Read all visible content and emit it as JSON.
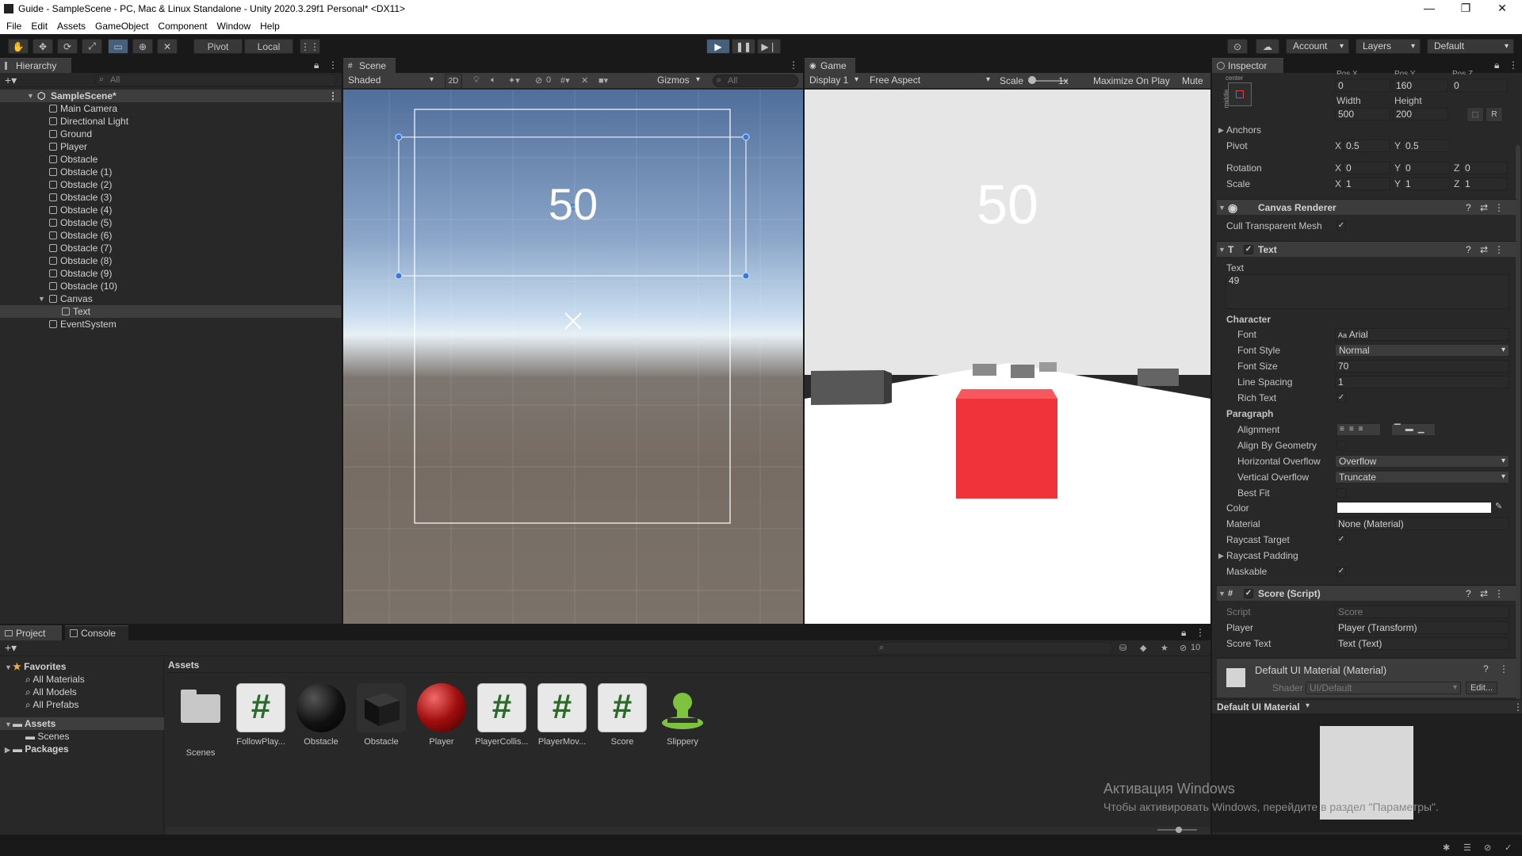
{
  "window": {
    "title": "Guide - SampleScene - PC, Mac & Linux Standalone - Unity 2020.3.29f1 Personal* <DX11>",
    "minimize": "—",
    "maximize": "❐",
    "close": "✕"
  },
  "menu": [
    "File",
    "Edit",
    "Assets",
    "GameObject",
    "Component",
    "Window",
    "Help"
  ],
  "toolbar": {
    "pivot_label": "Pivot",
    "local_label": "Local",
    "account_label": "Account",
    "layers_label": "Layers",
    "layout_label": "Default"
  },
  "hierarchy": {
    "tab_label": "Hierarchy",
    "search_placeholder": "All",
    "scene_name": "SampleScene*",
    "items": [
      "Main Camera",
      "Directional Light",
      "Ground",
      "Player",
      "Obstacle",
      "Obstacle (1)",
      "Obstacle (2)",
      "Obstacle (3)",
      "Obstacle (4)",
      "Obstacle (5)",
      "Obstacle (6)",
      "Obstacle (7)",
      "Obstacle (8)",
      "Obstacle (9)",
      "Obstacle (10)",
      "Canvas"
    ],
    "child_item": "Text",
    "last_item": "EventSystem"
  },
  "scene": {
    "tab_label": "Scene",
    "shading_mode": "Shaded",
    "btn_2d": "2D",
    "hidden_count": "0",
    "gizmos_label": "Gizmos",
    "search_placeholder": "All",
    "ui_text": "50"
  },
  "game": {
    "tab_label": "Game",
    "display": "Display 1",
    "aspect": "Free Aspect",
    "scale_label": "Scale",
    "scale_value": "1x",
    "maximize_label": "Maximize On Play",
    "mute_label": "Mute",
    "score_text": "50",
    "sky_color": "#e6e6e6",
    "ground_color": "#ffffff",
    "player_color": "#f0323a"
  },
  "inspector": {
    "tab_label": "Inspector",
    "rect": {
      "posx_label": "Pos X",
      "posy_label": "Pos Y",
      "posz_label": "Pos Z",
      "posx": "0",
      "posy": "160",
      "posz": "0",
      "width_label": "Width",
      "height_label": "Height",
      "width": "500",
      "height": "200",
      "anchor_preset_top": "center",
      "anchor_preset_side": "middle",
      "anchors_label": "Anchors",
      "pivot_label": "Pivot",
      "pivot_x": "0.5",
      "pivot_y": "0.5",
      "rotation_label": "Rotation",
      "rot_x": "0",
      "rot_y": "0",
      "rot_z": "0",
      "scale_label": "Scale",
      "scale_x": "1",
      "scale_y": "1",
      "scale_z": "1",
      "r_button": "R"
    },
    "axis_labels": {
      "x": "X",
      "y": "Y",
      "z": "Z"
    },
    "canvas_renderer": {
      "title": "Canvas Renderer",
      "cull_label": "Cull Transparent Mesh"
    },
    "text_comp": {
      "title": "Text",
      "text_label": "Text",
      "text_value": "49",
      "character_label": "Character",
      "font_label": "Font",
      "font_value": "Arial",
      "font_style_label": "Font Style",
      "font_style_value": "Normal",
      "font_size_label": "Font Size",
      "font_size_value": "70",
      "line_spacing_label": "Line Spacing",
      "line_spacing_value": "1",
      "rich_text_label": "Rich Text",
      "paragraph_label": "Paragraph",
      "alignment_label": "Alignment",
      "align_geom_label": "Align By Geometry",
      "h_overflow_label": "Horizontal Overflow",
      "h_overflow_value": "Overflow",
      "v_overflow_label": "Vertical Overflow",
      "v_overflow_value": "Truncate",
      "best_fit_label": "Best Fit",
      "color_label": "Color",
      "color_value": "#ffffff",
      "material_label": "Material",
      "material_value": "None (Material)",
      "raycast_target_label": "Raycast Target",
      "raycast_padding_label": "Raycast Padding",
      "maskable_label": "Maskable"
    },
    "score_comp": {
      "title": "Score (Script)",
      "script_label": "Script",
      "script_value": "Score",
      "player_label": "Player",
      "player_value": "Player (Transform)",
      "score_text_label": "Score Text",
      "score_text_value": "Text (Text)"
    },
    "material": {
      "title": "Default UI Material (Material)",
      "shader_label": "Shader",
      "shader_value": "UI/Default",
      "edit_label": "Edit...",
      "preview_label": "Default UI Material"
    }
  },
  "project": {
    "tab_project": "Project",
    "tab_console": "Console",
    "hidden_count": "10",
    "favorites_label": "Favorites",
    "favorites": [
      "All Materials",
      "All Models",
      "All Prefabs"
    ],
    "assets_label": "Assets",
    "assets_children": [
      "Scenes"
    ],
    "packages_label": "Packages",
    "breadcrumb": "Assets",
    "assets": [
      {
        "name": "Scenes",
        "kind": "folder"
      },
      {
        "name": "FollowPlay...",
        "kind": "script"
      },
      {
        "name": "Obstacle",
        "kind": "material-black"
      },
      {
        "name": "Obstacle",
        "kind": "prefab-cube"
      },
      {
        "name": "Player",
        "kind": "material-red"
      },
      {
        "name": "PlayerCollis...",
        "kind": "script"
      },
      {
        "name": "PlayerMov...",
        "kind": "script"
      },
      {
        "name": "Score",
        "kind": "script"
      },
      {
        "name": "Slippery",
        "kind": "physics-material"
      }
    ]
  },
  "watermark": {
    "line1": "Активация Windows",
    "line2": "Чтобы активировать Windows, перейдите в раздел \"Параметры\"."
  }
}
